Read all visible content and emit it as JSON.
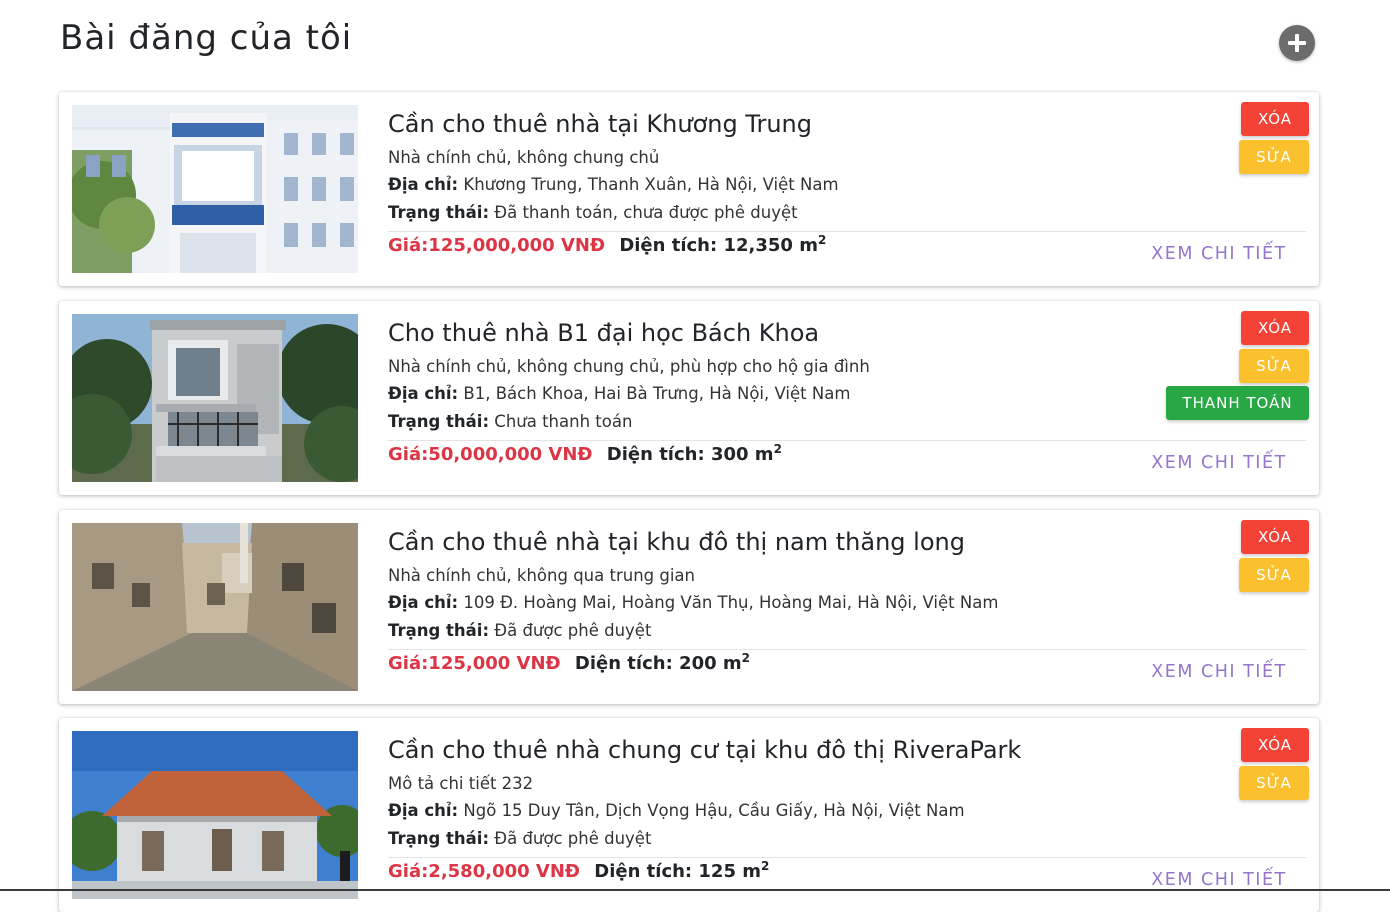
{
  "page": {
    "title": "Bài đăng của tôi",
    "add_icon": "plus-circle-icon"
  },
  "labels": {
    "address": "Địa chỉ:",
    "status": "Trạng thái:",
    "area": "Diện tích:",
    "area_unit": "m",
    "area_unit_power": "2",
    "delete": "XÓA",
    "edit": "SỬA",
    "pay": "THANH TOÁN",
    "detail": "XEM CHI TIẾT"
  },
  "colors": {
    "delete": "#f44336",
    "edit": "#fbc02d",
    "pay": "#28a745",
    "price": "#dc3545",
    "detail": "#9575cd"
  },
  "posts": [
    {
      "title": "Cần cho thuê nhà tại Khương Trung",
      "description": "Nhà chính chủ, không chung chủ",
      "address": "Khương Trung, Thanh Xuân, Hà Nội, Việt Nam",
      "status": "Đã thanh toán, chưa được phê duyệt",
      "price": "Giá:125,000,000 VNĐ",
      "area": "12,350",
      "image": "townhouse-white-facade",
      "show_pay": false
    },
    {
      "title": "Cho thuê nhà B1 đại học Bách Khoa",
      "description": "Nhà chính chủ, không chung chủ, phù hợp cho hộ gia đình",
      "address": "B1, Bách Khoa, Hai Bà Trưng, Hà Nội, Việt Nam",
      "status": "Chưa thanh toán",
      "price": "Giá:50,000,000 VNĐ",
      "area": "300",
      "image": "two-storey-house-balcony",
      "show_pay": true
    },
    {
      "title": "Cần cho thuê nhà tại khu đô thị nam thăng long",
      "description": "Nhà chính chủ, không qua trung gian",
      "address": "109 Đ. Hoàng Mai, Hoàng Văn Thụ, Hoàng Mai, Hà Nội, Việt Nam",
      "status": "Đã được phê duyệt",
      "price": "Giá:125,000 VNĐ",
      "area": "200",
      "image": "narrow-old-street",
      "show_pay": false
    },
    {
      "title": "Cần cho thuê nhà chung cư tại khu đô thị RiveraPark",
      "description": "Mô tả chi tiết 232",
      "address": "Ngõ 15 Duy Tân, Dịch Vọng Hậu, Cầu Giấy, Hà Nội, Việt Nam",
      "status": "Đã được phê duyệt",
      "price": "Giá:2,580,000 VNĐ",
      "area": "125",
      "image": "single-storey-villa",
      "show_pay": false
    }
  ]
}
